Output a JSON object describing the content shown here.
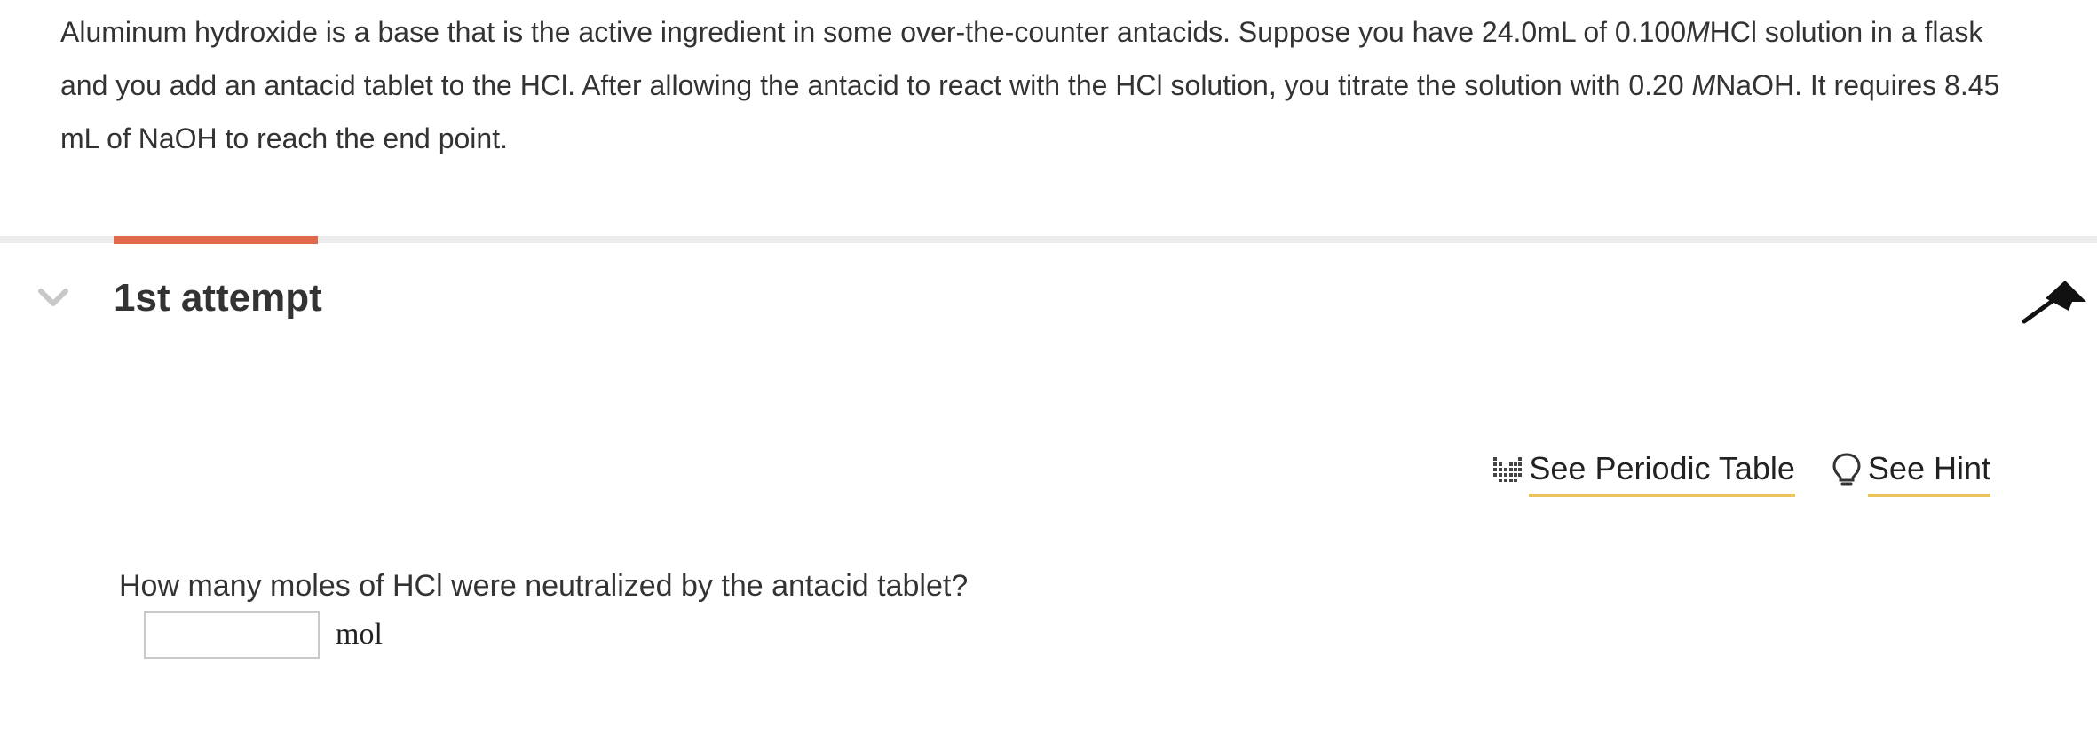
{
  "problem": {
    "text_part1": "Aluminum hydroxide is a base that is the active ingredient in some over-the-counter antacids. Suppose you have  24.0mL of  0.100",
    "unit_M1": "M",
    "text_part2": "HCl solution in a flask and you add an antacid tablet to the HCl. After allowing the antacid to react with the HCl solution, you titrate the solution with 0.20 ",
    "unit_M2": "M",
    "text_part3": "NaOH. It requires 8.45 mL of NaOH to reach the end point."
  },
  "attempt": {
    "title": "1st attempt",
    "collapse_icon": "chevron-down-icon",
    "pin_icon": "pin-icon"
  },
  "tools": {
    "periodic_table_label": "See Periodic Table",
    "periodic_table_icon": "periodic-table-icon",
    "hint_label": "See Hint",
    "hint_icon": "lightbulb-icon",
    "underline_color": "#e8c45a"
  },
  "question": {
    "text": "How many moles of HCl were neutralized by the antacid tablet?",
    "answer_value": "",
    "unit": "mol"
  },
  "colors": {
    "accent": "#e0684b",
    "divider": "#ececec",
    "text": "#333333"
  }
}
